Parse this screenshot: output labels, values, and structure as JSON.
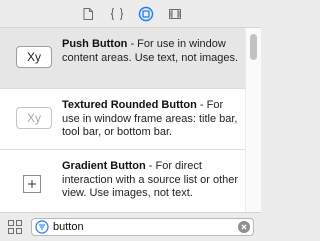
{
  "toolbar": {
    "tabs": [
      {
        "icon": "file-icon",
        "selected": false
      },
      {
        "icon": "braces-icon",
        "selected": false
      },
      {
        "icon": "object-library-icon",
        "selected": true
      },
      {
        "icon": "media-library-icon",
        "selected": false
      }
    ],
    "accent_color": "#1a7cf5"
  },
  "library": {
    "items": [
      {
        "thumbnail_text": "Xy",
        "title": "Push Button",
        "description": " - For use in window content areas. Use text, not images.",
        "selected": true
      },
      {
        "thumbnail_text": "Xy",
        "title": "Textured Rounded Button",
        "description": " - For use in window frame areas: title bar, tool bar, or bottom bar.",
        "selected": false
      },
      {
        "thumbnail_icon": "plus-icon",
        "title": "Gradient Button",
        "description": " - For direct interaction with a source list or other view. Use images, not text.",
        "selected": false
      }
    ]
  },
  "filter": {
    "value": "button",
    "view_mode_icon": "grid-view-icon"
  }
}
